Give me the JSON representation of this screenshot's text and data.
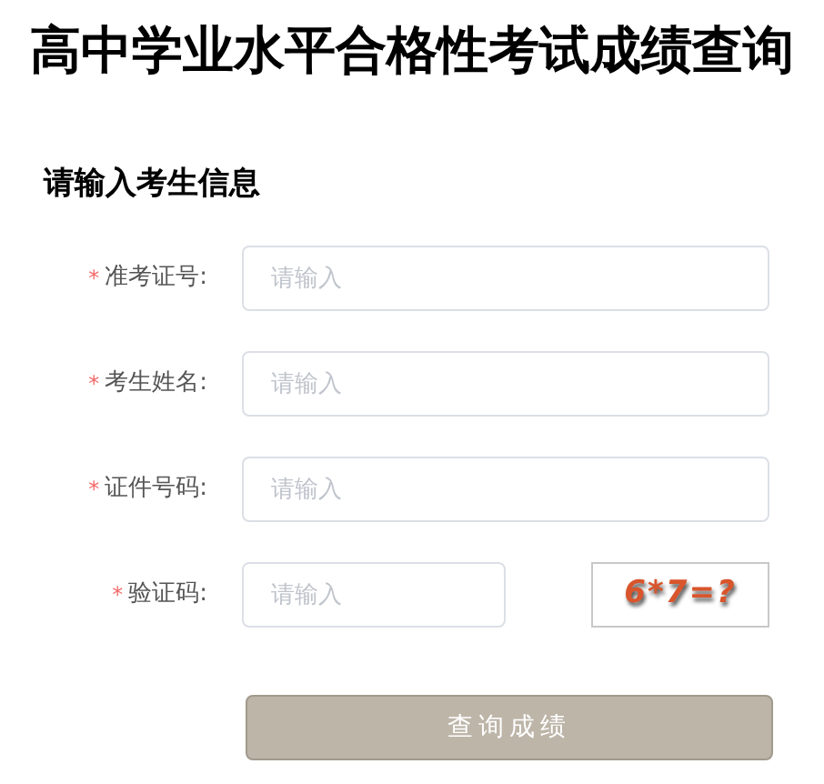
{
  "title": "高中学业水平合格性考试成绩查询",
  "section_title": "请输入考生信息",
  "fields": [
    {
      "kind": "text",
      "required_mark": "*",
      "label": "准考证号:",
      "placeholder": "请输入"
    },
    {
      "kind": "text",
      "required_mark": "*",
      "label": "考生姓名:",
      "placeholder": "请输入"
    },
    {
      "kind": "text",
      "required_mark": "*",
      "label": "证件号码:",
      "placeholder": "请输入"
    },
    {
      "kind": "captcha",
      "required_mark": "*",
      "label": "验证码:",
      "placeholder": "请输入",
      "captcha": "6*7=?"
    }
  ],
  "submit": {
    "label": "查询成绩"
  }
}
